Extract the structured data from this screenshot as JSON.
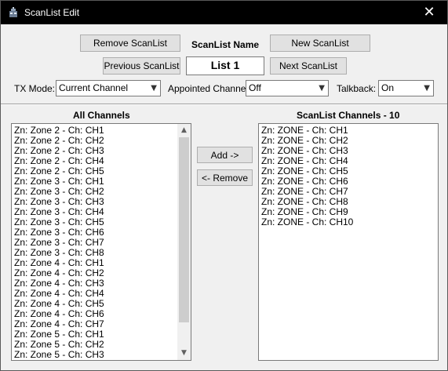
{
  "window": {
    "title": "ScanList Edit",
    "close_glyph": "✕"
  },
  "top": {
    "remove_label": "Remove ScanList",
    "name_label": "ScanList Name",
    "new_label": "New ScanList",
    "previous_label": "Previous ScanList",
    "name_value": "List 1",
    "next_label": "Next ScanList"
  },
  "options": {
    "tx_mode_label": "TX Mode:",
    "tx_mode_value": "Current Channel",
    "appointed_label": "Appointed Channel:",
    "appointed_value": "Off",
    "talkback_label": "Talkback:",
    "talkback_value": "On"
  },
  "all_channels": {
    "heading": "All Channels",
    "items": [
      "Zn: Zone 2 - Ch: CH1",
      "Zn: Zone 2 - Ch: CH2",
      "Zn: Zone 2 - Ch: CH3",
      "Zn: Zone 2 - Ch: CH4",
      "Zn: Zone 2 - Ch: CH5",
      "Zn: Zone 3 - Ch: CH1",
      "Zn: Zone 3 - Ch: CH2",
      "Zn: Zone 3 - Ch: CH3",
      "Zn: Zone 3 - Ch: CH4",
      "Zn: Zone 3 - Ch: CH5",
      "Zn: Zone 3 - Ch: CH6",
      "Zn: Zone 3 - Ch: CH7",
      "Zn: Zone 3 - Ch: CH8",
      "Zn: Zone 4 - Ch: CH1",
      "Zn: Zone 4 - Ch: CH2",
      "Zn: Zone 4 - Ch: CH3",
      "Zn: Zone 4 - Ch: CH4",
      "Zn: Zone 4 - Ch: CH5",
      "Zn: Zone 4 - Ch: CH6",
      "Zn: Zone 4 - Ch: CH7",
      "Zn: Zone 5 - Ch: CH1",
      "Zn: Zone 5 - Ch: CH2",
      "Zn: Zone 5 - Ch: CH3"
    ]
  },
  "actions": {
    "add_label": "Add ->",
    "remove_label": "<- Remove"
  },
  "scan_channels": {
    "heading": "ScanList Channels - 10",
    "items": [
      "Zn: ZONE - Ch: CH1",
      "Zn: ZONE - Ch: CH2",
      "Zn: ZONE - Ch: CH3",
      "Zn: ZONE - Ch: CH4",
      "Zn: ZONE - Ch: CH5",
      "Zn: ZONE - Ch: CH6",
      "Zn: ZONE - Ch: CH7",
      "Zn: ZONE - Ch: CH8",
      "Zn: ZONE - Ch: CH9",
      "Zn: ZONE - Ch: CH10"
    ]
  },
  "icons": {
    "app": "radio-tower-icon",
    "close": "close-icon",
    "dropdown": "chevron-down-icon",
    "scroll_up": "scroll-up-arrow-icon",
    "scroll_down": "scroll-down-arrow-icon"
  }
}
